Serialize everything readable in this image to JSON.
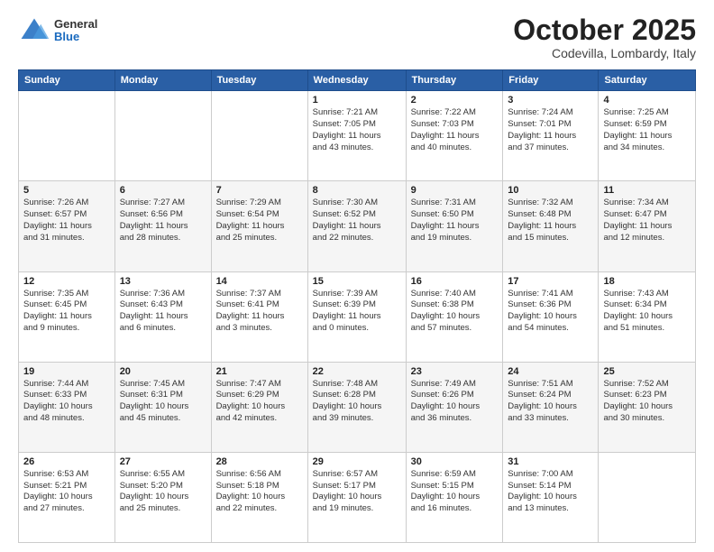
{
  "logo": {
    "general": "General",
    "blue": "Blue"
  },
  "header": {
    "month": "October 2025",
    "location": "Codevilla, Lombardy, Italy"
  },
  "weekdays": [
    "Sunday",
    "Monday",
    "Tuesday",
    "Wednesday",
    "Thursday",
    "Friday",
    "Saturday"
  ],
  "weeks": [
    [
      {
        "day": "",
        "info": ""
      },
      {
        "day": "",
        "info": ""
      },
      {
        "day": "",
        "info": ""
      },
      {
        "day": "1",
        "info": "Sunrise: 7:21 AM\nSunset: 7:05 PM\nDaylight: 11 hours\nand 43 minutes."
      },
      {
        "day": "2",
        "info": "Sunrise: 7:22 AM\nSunset: 7:03 PM\nDaylight: 11 hours\nand 40 minutes."
      },
      {
        "day": "3",
        "info": "Sunrise: 7:24 AM\nSunset: 7:01 PM\nDaylight: 11 hours\nand 37 minutes."
      },
      {
        "day": "4",
        "info": "Sunrise: 7:25 AM\nSunset: 6:59 PM\nDaylight: 11 hours\nand 34 minutes."
      }
    ],
    [
      {
        "day": "5",
        "info": "Sunrise: 7:26 AM\nSunset: 6:57 PM\nDaylight: 11 hours\nand 31 minutes."
      },
      {
        "day": "6",
        "info": "Sunrise: 7:27 AM\nSunset: 6:56 PM\nDaylight: 11 hours\nand 28 minutes."
      },
      {
        "day": "7",
        "info": "Sunrise: 7:29 AM\nSunset: 6:54 PM\nDaylight: 11 hours\nand 25 minutes."
      },
      {
        "day": "8",
        "info": "Sunrise: 7:30 AM\nSunset: 6:52 PM\nDaylight: 11 hours\nand 22 minutes."
      },
      {
        "day": "9",
        "info": "Sunrise: 7:31 AM\nSunset: 6:50 PM\nDaylight: 11 hours\nand 19 minutes."
      },
      {
        "day": "10",
        "info": "Sunrise: 7:32 AM\nSunset: 6:48 PM\nDaylight: 11 hours\nand 15 minutes."
      },
      {
        "day": "11",
        "info": "Sunrise: 7:34 AM\nSunset: 6:47 PM\nDaylight: 11 hours\nand 12 minutes."
      }
    ],
    [
      {
        "day": "12",
        "info": "Sunrise: 7:35 AM\nSunset: 6:45 PM\nDaylight: 11 hours\nand 9 minutes."
      },
      {
        "day": "13",
        "info": "Sunrise: 7:36 AM\nSunset: 6:43 PM\nDaylight: 11 hours\nand 6 minutes."
      },
      {
        "day": "14",
        "info": "Sunrise: 7:37 AM\nSunset: 6:41 PM\nDaylight: 11 hours\nand 3 minutes."
      },
      {
        "day": "15",
        "info": "Sunrise: 7:39 AM\nSunset: 6:39 PM\nDaylight: 11 hours\nand 0 minutes."
      },
      {
        "day": "16",
        "info": "Sunrise: 7:40 AM\nSunset: 6:38 PM\nDaylight: 10 hours\nand 57 minutes."
      },
      {
        "day": "17",
        "info": "Sunrise: 7:41 AM\nSunset: 6:36 PM\nDaylight: 10 hours\nand 54 minutes."
      },
      {
        "day": "18",
        "info": "Sunrise: 7:43 AM\nSunset: 6:34 PM\nDaylight: 10 hours\nand 51 minutes."
      }
    ],
    [
      {
        "day": "19",
        "info": "Sunrise: 7:44 AM\nSunset: 6:33 PM\nDaylight: 10 hours\nand 48 minutes."
      },
      {
        "day": "20",
        "info": "Sunrise: 7:45 AM\nSunset: 6:31 PM\nDaylight: 10 hours\nand 45 minutes."
      },
      {
        "day": "21",
        "info": "Sunrise: 7:47 AM\nSunset: 6:29 PM\nDaylight: 10 hours\nand 42 minutes."
      },
      {
        "day": "22",
        "info": "Sunrise: 7:48 AM\nSunset: 6:28 PM\nDaylight: 10 hours\nand 39 minutes."
      },
      {
        "day": "23",
        "info": "Sunrise: 7:49 AM\nSunset: 6:26 PM\nDaylight: 10 hours\nand 36 minutes."
      },
      {
        "day": "24",
        "info": "Sunrise: 7:51 AM\nSunset: 6:24 PM\nDaylight: 10 hours\nand 33 minutes."
      },
      {
        "day": "25",
        "info": "Sunrise: 7:52 AM\nSunset: 6:23 PM\nDaylight: 10 hours\nand 30 minutes."
      }
    ],
    [
      {
        "day": "26",
        "info": "Sunrise: 6:53 AM\nSunset: 5:21 PM\nDaylight: 10 hours\nand 27 minutes."
      },
      {
        "day": "27",
        "info": "Sunrise: 6:55 AM\nSunset: 5:20 PM\nDaylight: 10 hours\nand 25 minutes."
      },
      {
        "day": "28",
        "info": "Sunrise: 6:56 AM\nSunset: 5:18 PM\nDaylight: 10 hours\nand 22 minutes."
      },
      {
        "day": "29",
        "info": "Sunrise: 6:57 AM\nSunset: 5:17 PM\nDaylight: 10 hours\nand 19 minutes."
      },
      {
        "day": "30",
        "info": "Sunrise: 6:59 AM\nSunset: 5:15 PM\nDaylight: 10 hours\nand 16 minutes."
      },
      {
        "day": "31",
        "info": "Sunrise: 7:00 AM\nSunset: 5:14 PM\nDaylight: 10 hours\nand 13 minutes."
      },
      {
        "day": "",
        "info": ""
      }
    ]
  ]
}
